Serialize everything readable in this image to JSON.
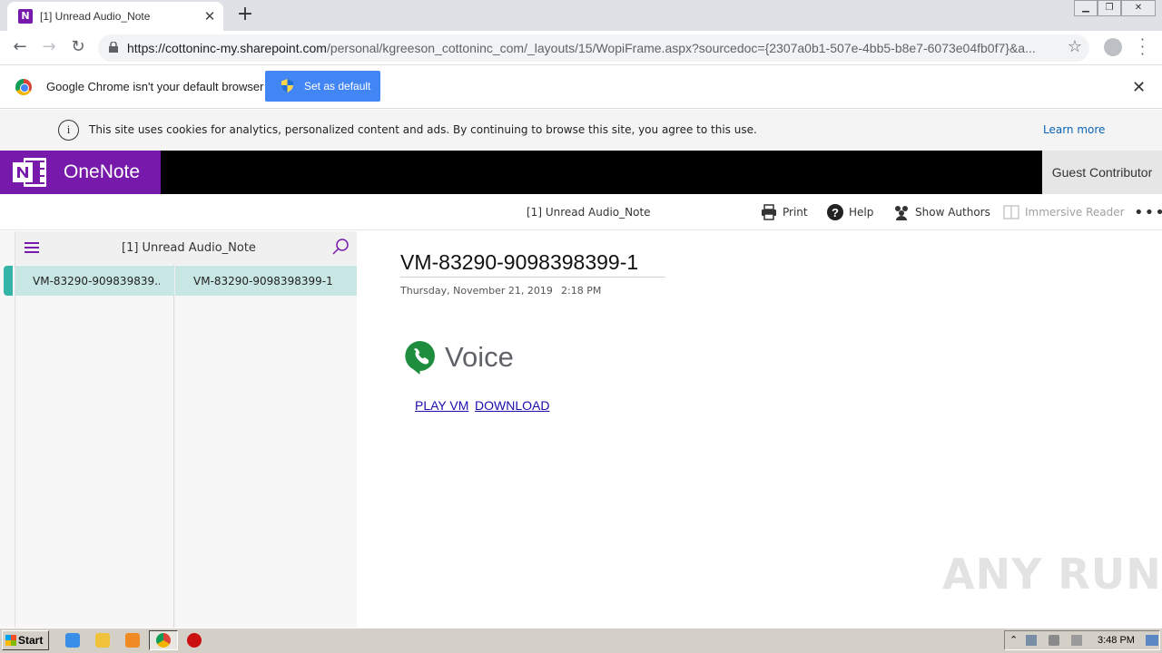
{
  "browser": {
    "tab_title": "[1] Unread Audio_Note",
    "url_host": "https://cottoninc-my.sharepoint.com",
    "url_path": "/personal/kgreeson_cottoninc_com/_layouts/15/WopiFrame.aspx?sourcedoc={2307a0b1-507e-4bb5-b8e7-6073e04fb0f7}&a...",
    "default_bar_text": "Google Chrome isn't your default browser",
    "set_default_label": "Set as default"
  },
  "cookie_bar": {
    "text": "This site uses cookies for analytics, personalized content and ads. By continuing to browse this site, you agree to this use.",
    "learn_more": "Learn more"
  },
  "onenote": {
    "app_name": "OneNote",
    "user": "Guest Contributor",
    "document_title": "[1] Unread Audio_Note",
    "commands": {
      "print": "Print",
      "help": "Help",
      "show_authors": "Show Authors",
      "immersive_reader": "Immersive Reader"
    },
    "notebook_title": "[1] Unread Audio_Note",
    "sections": [
      {
        "label": "VM-83290-909839839..."
      }
    ],
    "pages": [
      {
        "label": "VM-83290-9098398399-1"
      }
    ]
  },
  "page": {
    "title": "VM-83290-9098398399-1",
    "date": "Thursday, November 21, 2019",
    "time": "2:18 PM",
    "voice_word": "Voice",
    "play_link": "PLAY VM",
    "download_link": "DOWNLOAD"
  },
  "watermark": "ANY RUN",
  "taskbar": {
    "start_label": "Start",
    "clock": "3:48 PM"
  },
  "colors": {
    "onenote_purple": "#7719aa",
    "selection_teal": "#c8e6e4",
    "section_marker": "#33b4a6",
    "chrome_blue": "#4285f4",
    "voice_green": "#1e8e3e"
  }
}
